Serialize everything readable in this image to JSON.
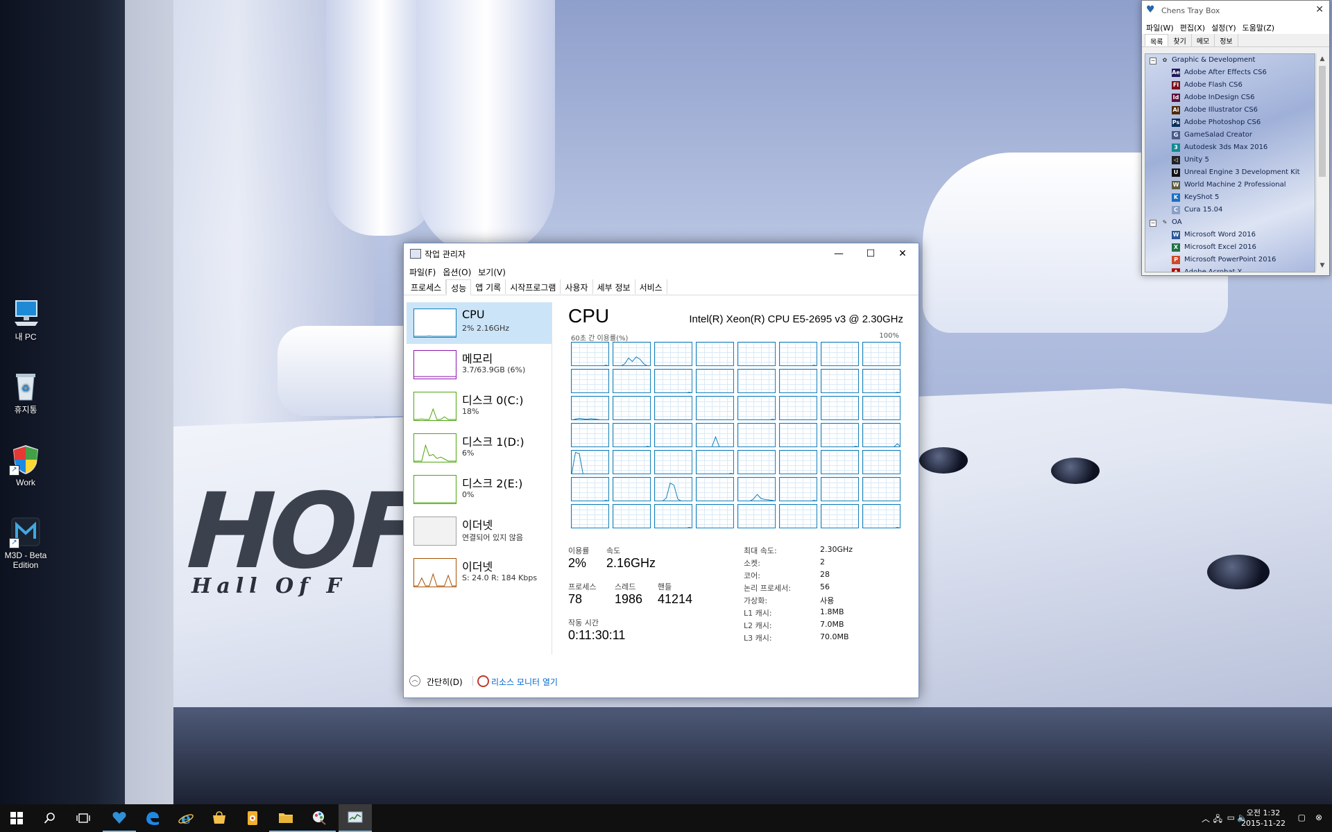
{
  "desktop": {
    "icons": [
      {
        "label": "내 PC",
        "icon": "computer-icon"
      },
      {
        "label": "휴지통",
        "icon": "recycle-bin-icon"
      },
      {
        "label": "Work",
        "icon": "shield-icon"
      },
      {
        "label": "M3D - Beta Edition",
        "icon": "m3d-icon"
      }
    ]
  },
  "task_manager": {
    "title": "작업 관리자",
    "menu": [
      "파일(F)",
      "옵션(O)",
      "보기(V)"
    ],
    "tabs": [
      "프로세스",
      "성능",
      "앱 기록",
      "시작프로그램",
      "사용자",
      "세부 정보",
      "서비스"
    ],
    "active_tab": "성능",
    "sidebar": [
      {
        "name": "CPU",
        "sub": "2% 2.16GHz",
        "color": "#117dbb",
        "selected": true
      },
      {
        "name": "메모리",
        "sub": "3.7/63.9GB (6%)",
        "color": "#8b12ae",
        "selected": false
      },
      {
        "name": "디스크 0(C:)",
        "sub": "18%",
        "color": "#4da60c",
        "selected": false
      },
      {
        "name": "디스크 1(D:)",
        "sub": "6%",
        "color": "#4da60c",
        "selected": false
      },
      {
        "name": "디스크 2(E:)",
        "sub": "0%",
        "color": "#4da60c",
        "selected": false
      },
      {
        "name": "이더넷",
        "sub": "연결되어 있지 않음",
        "color": "#a0a0a0",
        "selected": false
      },
      {
        "name": "이더넷",
        "sub": "S: 24.0  R: 184 Kbps",
        "color": "#a74f01",
        "selected": false
      }
    ],
    "cpu": {
      "title": "CPU",
      "model": "Intel(R) Xeon(R) CPU E5-2695 v3 @ 2.30GHz",
      "graph_label": "60초 간 이용률(%)",
      "graph_max": "100%",
      "logical_core_graphs": 56,
      "utilization_label": "이용률",
      "utilization": "2%",
      "speed_label": "속도",
      "speed": "2.16GHz",
      "processes_label": "프로세스",
      "processes": "78",
      "threads_label": "스레드",
      "threads": "1986",
      "handles_label": "핸들",
      "handles": "41214",
      "uptime_label": "작동 시간",
      "uptime": "0:11:30:11",
      "specs": [
        {
          "key": "최대 속도:",
          "value": "2.30GHz"
        },
        {
          "key": "소켓:",
          "value": "2"
        },
        {
          "key": "코어:",
          "value": "28"
        },
        {
          "key": "논리 프로세서:",
          "value": "56"
        },
        {
          "key": "가상화:",
          "value": "사용"
        },
        {
          "key": "L1 캐시:",
          "value": "1.8MB"
        },
        {
          "key": "L2 캐시:",
          "value": "7.0MB"
        },
        {
          "key": "L3 캐시:",
          "value": "70.0MB"
        }
      ]
    },
    "footer": {
      "fewer_details": "간단히(D)",
      "resource_monitor": "리소스 모니터 열기"
    }
  },
  "tray_box": {
    "title": "Chens Tray Box",
    "menu": [
      "파일(W)",
      "편집(X)",
      "설정(Y)",
      "도움말(Z)"
    ],
    "tabs": [
      "목록",
      "찾기",
      "메모",
      "정보"
    ],
    "groups": [
      {
        "name": "Graphic & Development",
        "expander": "−",
        "items": [
          {
            "label": "Adobe After Effects CS6",
            "badge": "Ae",
            "color": "#1f1a57"
          },
          {
            "label": "Adobe Flash CS6",
            "badge": "Fl",
            "color": "#7a0f1c"
          },
          {
            "label": "Adobe InDesign CS6",
            "badge": "Id",
            "color": "#5c0f3c"
          },
          {
            "label": "Adobe Illustrator CS6",
            "badge": "Ai",
            "color": "#4d2a05"
          },
          {
            "label": "Adobe Photoshop CS6",
            "badge": "Ps",
            "color": "#0c2f5c"
          },
          {
            "label": "GameSalad Creator",
            "badge": "G",
            "color": "#4a5a8a"
          },
          {
            "label": "Autodesk 3ds Max 2016",
            "badge": "3",
            "color": "#138a92"
          },
          {
            "label": "Unity 5",
            "badge": "◁",
            "color": "#222222"
          },
          {
            "label": "Unreal Engine 3 Development Kit",
            "badge": "U",
            "color": "#111111"
          },
          {
            "label": "World Machine 2 Professional",
            "badge": "W",
            "color": "#5d5d40"
          },
          {
            "label": "KeyShot 5",
            "badge": "K",
            "color": "#1b6fc2"
          },
          {
            "label": "Cura 15.04",
            "badge": "C",
            "color": "#8aa0c8"
          }
        ]
      },
      {
        "name": "OA",
        "expander": "−",
        "items": [
          {
            "label": "Microsoft Word 2016",
            "badge": "W",
            "color": "#2b579a"
          },
          {
            "label": "Microsoft Excel 2016",
            "badge": "X",
            "color": "#217346"
          },
          {
            "label": "Microsoft PowerPoint 2016",
            "badge": "P",
            "color": "#d24726"
          },
          {
            "label": "Adobe Acrobat X",
            "badge": "A",
            "color": "#b30b00"
          }
        ]
      }
    ]
  },
  "taskbar": {
    "apps": [
      {
        "icon": "windows-start-icon"
      },
      {
        "icon": "search-icon"
      },
      {
        "icon": "task-view-icon"
      },
      {
        "icon": "tray-box-app-icon"
      },
      {
        "icon": "edge-browser-icon"
      },
      {
        "icon": "internet-explorer-icon"
      },
      {
        "icon": "store-icon"
      },
      {
        "icon": "media-app-icon"
      },
      {
        "icon": "file-explorer-icon"
      },
      {
        "icon": "paint-app-icon"
      },
      {
        "icon": "task-manager-icon"
      }
    ],
    "clock": {
      "time": "오전 1:32",
      "date": "2015-11-22"
    }
  }
}
